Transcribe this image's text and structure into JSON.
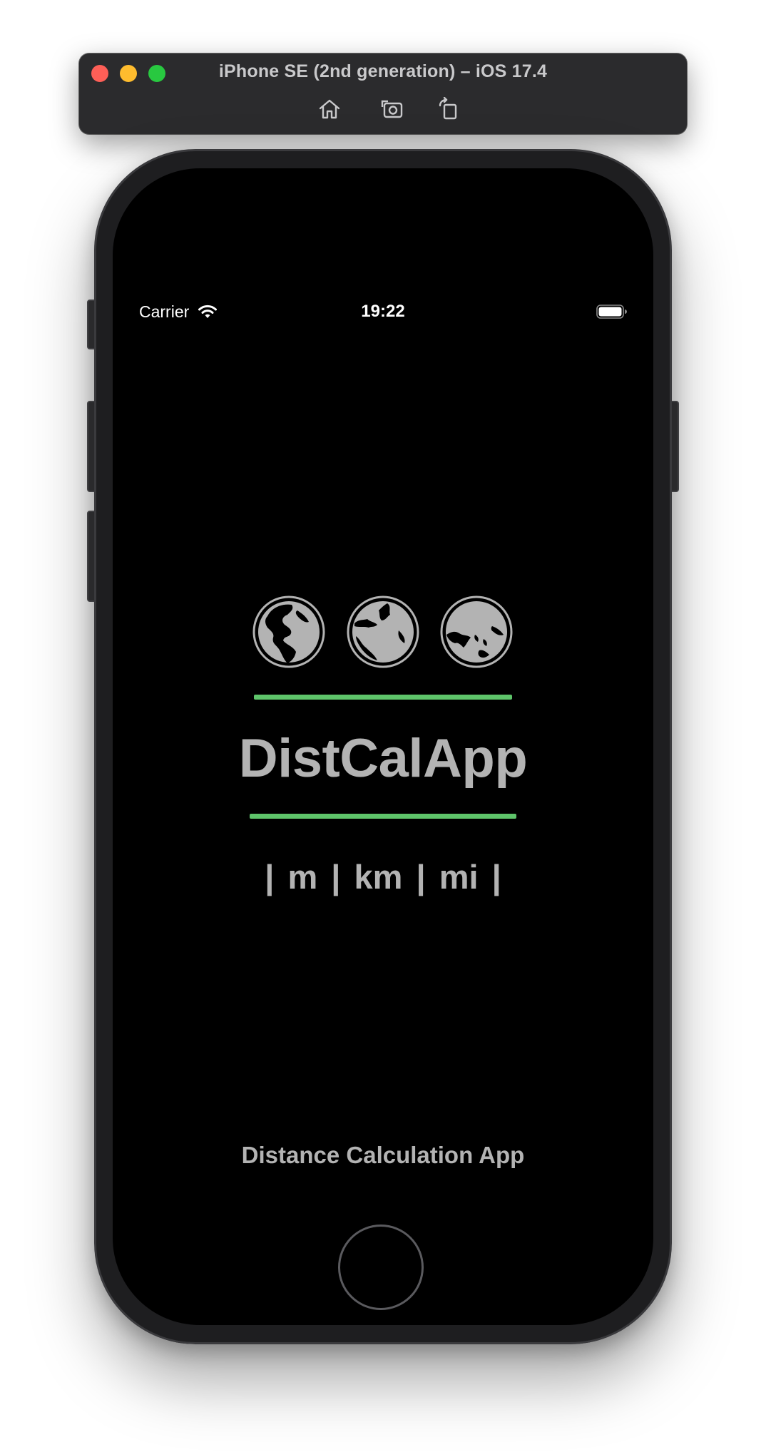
{
  "window": {
    "title": "iPhone SE (2nd generation) – iOS 17.4",
    "toolbar": {
      "home_icon": "home-icon",
      "screenshot_icon": "camera-icon",
      "rotate_icon": "rotate-icon"
    }
  },
  "status_bar": {
    "carrier": "Carrier",
    "time": "19:22",
    "wifi_icon": "wifi-icon",
    "battery_icon": "battery-icon"
  },
  "app": {
    "globes": [
      "globe-americas-icon",
      "globe-europe-africa-icon",
      "globe-asia-australia-icon"
    ],
    "title": "DistCalApp",
    "units": "| m | km | mi |",
    "tagline": "Distance Calculation App",
    "accent_color": "#5ec46a",
    "text_color": "#b3b3b3"
  }
}
